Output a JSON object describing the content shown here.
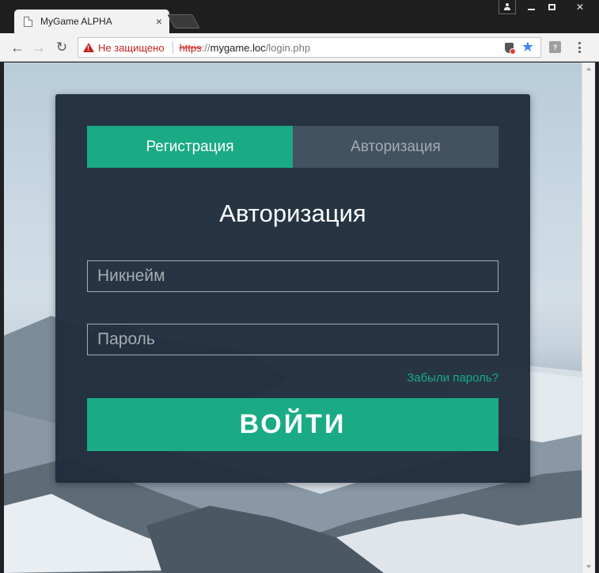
{
  "browser": {
    "tab_title": "MyGame ALPHA",
    "tab_close": "×",
    "nav": {
      "back": "←",
      "forward": "→",
      "reload": "↻"
    },
    "security_label": "Не защищено",
    "url": {
      "scheme": "https",
      "separator": "://",
      "host": "mygame.loc",
      "path": "/login.php"
    },
    "star": "★",
    "window": {
      "close": "✕"
    }
  },
  "auth": {
    "tabs": [
      {
        "label": "Регистрация",
        "active": true
      },
      {
        "label": "Авторизация",
        "active": false
      }
    ],
    "heading": "Авторизация",
    "nickname_placeholder": "Никнейм",
    "password_placeholder": "Пароль",
    "forgot_label": "Забыли пароль?",
    "submit_label": "ВОЙТИ"
  },
  "colors": {
    "accent": "#1aab85",
    "card_bg": "#1f2d3c",
    "inactive_tab": "#435260",
    "warning": "#c5221f"
  }
}
